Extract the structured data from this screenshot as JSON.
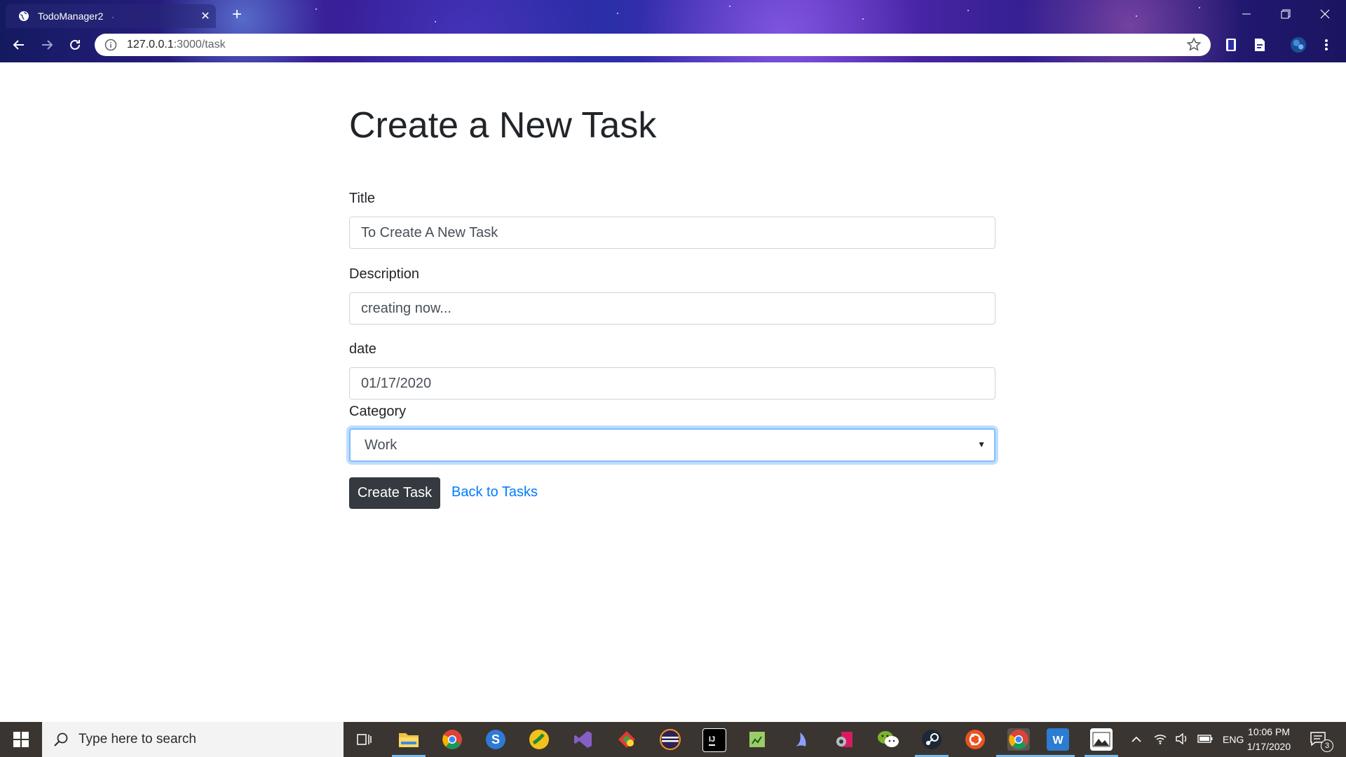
{
  "browser": {
    "tab_title": "TodoManager2",
    "url_host": "127.0.0.1",
    "url_path": ":3000/task",
    "new_tab_label": "+"
  },
  "page": {
    "heading": "Create a New Task",
    "title_label": "Title",
    "title_value": "To Create A New Task",
    "description_label": "Description",
    "description_value": "creating now...",
    "date_label": "date",
    "date_value": "01/17/2020",
    "category_label": "Category",
    "category_value": "Work",
    "create_button": "Create Task",
    "back_link": "Back to Tasks"
  },
  "taskbar": {
    "search_placeholder": "Type here to search",
    "language": "ENG",
    "time": "10:06 PM",
    "date": "1/17/2020",
    "notification_count": "3"
  },
  "colors": {
    "primary_link": "#007bff",
    "dark_button": "#343a40",
    "focus_border": "#80bdff"
  }
}
